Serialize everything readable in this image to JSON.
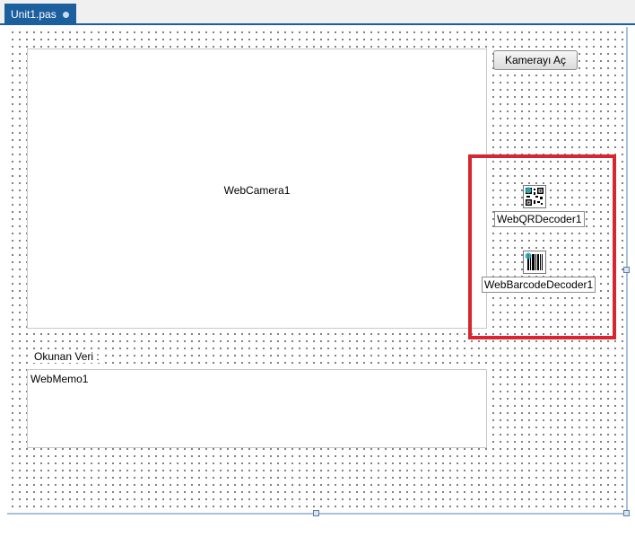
{
  "tab": {
    "label": "Unit1.pas"
  },
  "form": {
    "camera_label": "WebCamera1",
    "open_camera_button": "Kamerayı Aç",
    "read_data_label": "Okunan Veri :",
    "memo_label": "WebMemo1"
  },
  "components": {
    "qr": {
      "label": "WebQRDecoder1",
      "icon": "qr-code-icon"
    },
    "barcode": {
      "label": "WebBarcodeDecoder1",
      "icon": "barcode-icon"
    }
  },
  "colors": {
    "highlight": "#d9252f",
    "tab": "#1c5f9e"
  }
}
